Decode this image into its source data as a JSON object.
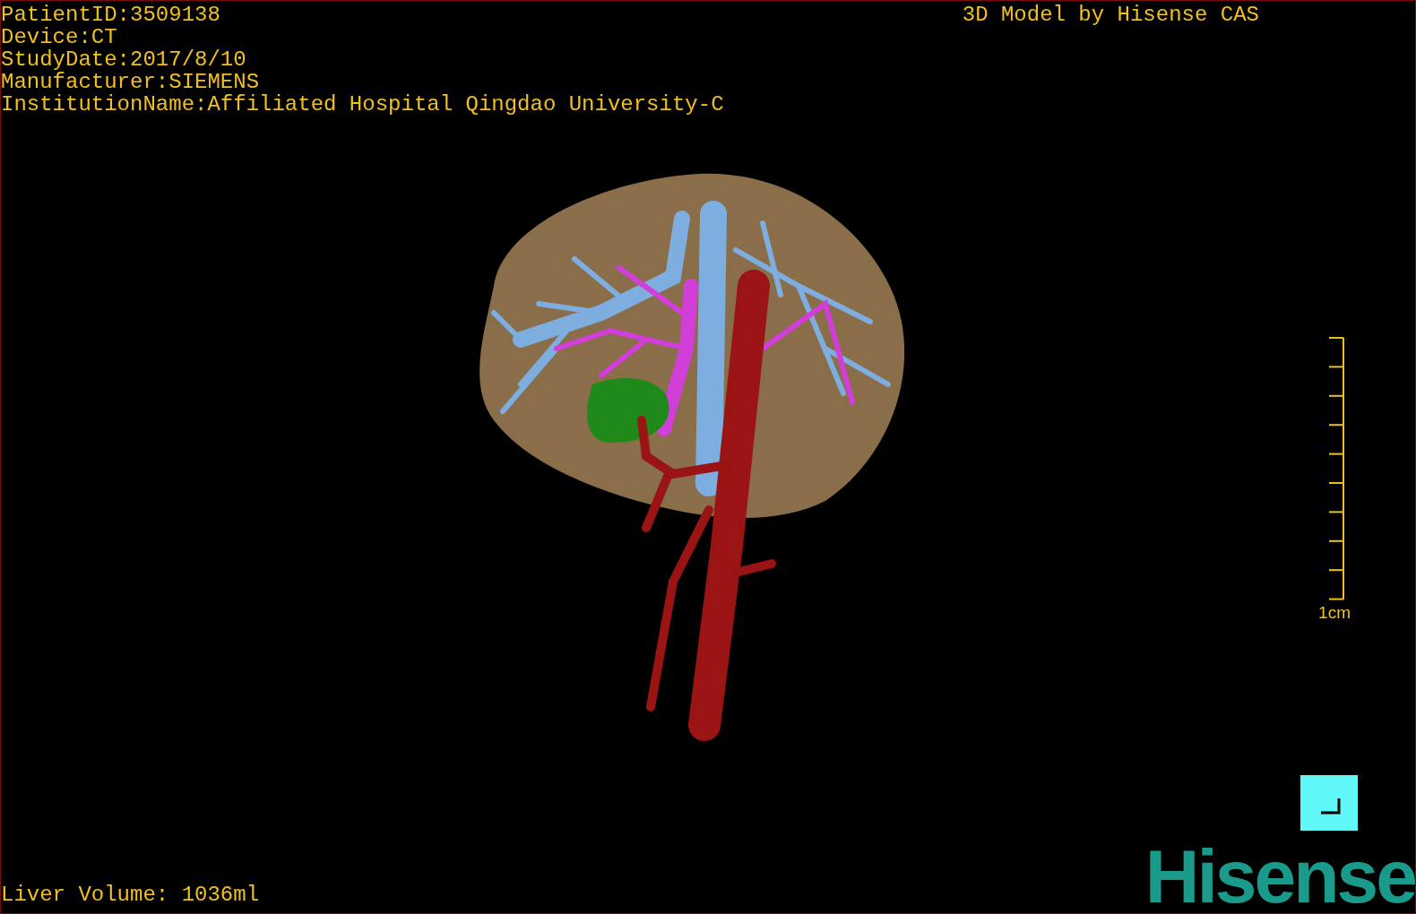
{
  "patient_info": [
    {
      "text": "PatientID:3509138"
    },
    {
      "text": "Device:CT"
    },
    {
      "text": "StudyDate:2017/8/10"
    },
    {
      "text": "Manufacturer:SIEMENS"
    },
    {
      "text": "InstitutionName:Affiliated Hospital Qingdao University-C"
    }
  ],
  "title": "3D Model by Hisense CAS",
  "scale_bar": {
    "label": "1cm"
  },
  "liver_volume": "Liver Volume: 1036ml",
  "logo": "Hisense"
}
